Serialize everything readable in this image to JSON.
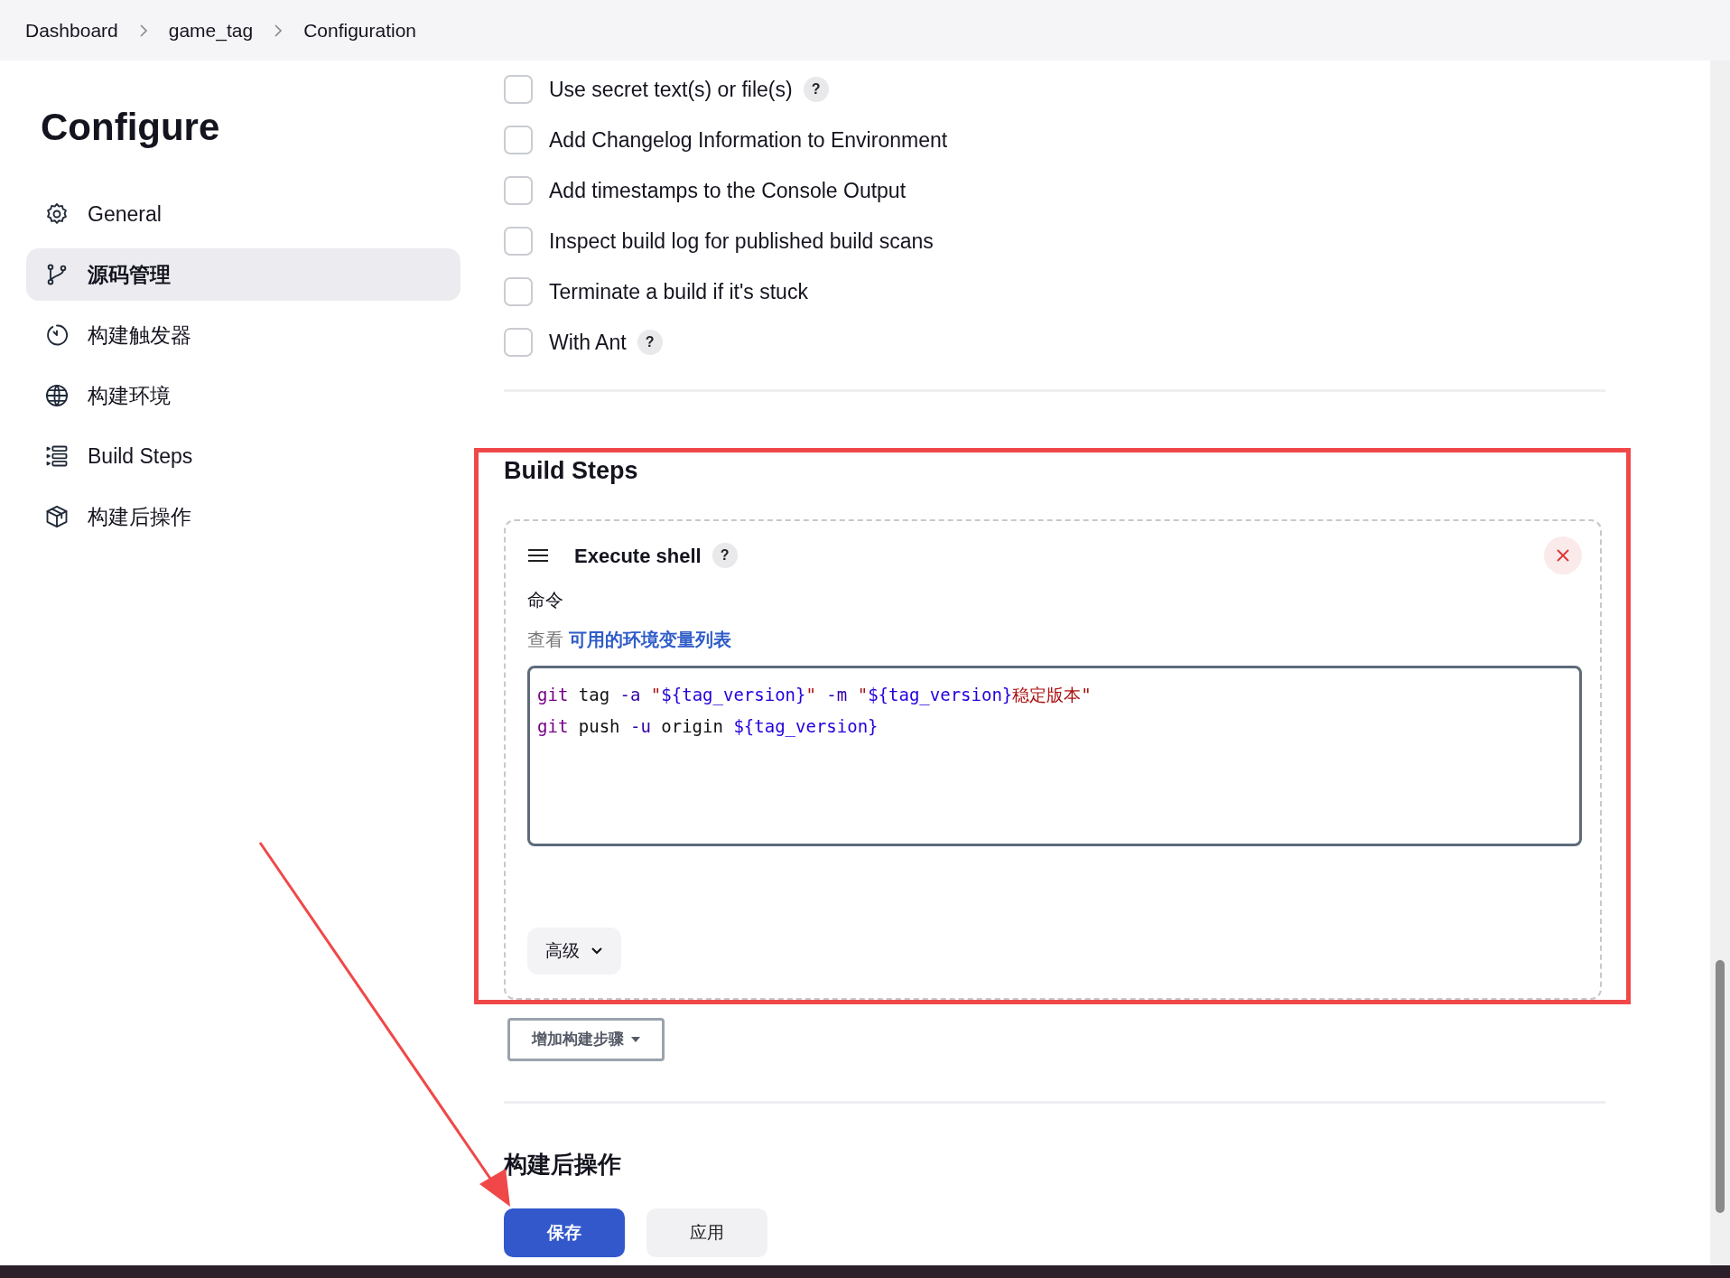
{
  "breadcrumbs": [
    "Dashboard",
    "game_tag",
    "Configuration"
  ],
  "sidebar": {
    "title": "Configure",
    "items": [
      {
        "label": "General",
        "selected": false
      },
      {
        "label": "源码管理",
        "selected": true
      },
      {
        "label": "构建触发器",
        "selected": false
      },
      {
        "label": "构建环境",
        "selected": false
      },
      {
        "label": "Build Steps",
        "selected": false
      },
      {
        "label": "构建后操作",
        "selected": false
      }
    ]
  },
  "options": [
    {
      "label": "Use secret text(s) or file(s)",
      "checked": false,
      "help": "?"
    },
    {
      "label": "Add Changelog Information to Environment",
      "checked": false
    },
    {
      "label": "Add timestamps to the Console Output",
      "checked": false
    },
    {
      "label": "Inspect build log for published build scans",
      "checked": false
    },
    {
      "label": "Terminate a build if it's stuck",
      "checked": false
    },
    {
      "label": "With Ant",
      "checked": false,
      "help": "?"
    }
  ],
  "build_steps": {
    "title": "Build Steps",
    "step": {
      "title": "Execute shell",
      "help": "?",
      "field_label": "命令",
      "hint_prefix": "查看",
      "hint_link": "可用的环境变量列表",
      "code": [
        [
          {
            "kind": "keyword",
            "text": "git"
          },
          {
            "kind": "plain",
            "text": " tag "
          },
          {
            "kind": "flag",
            "text": "-a "
          },
          {
            "kind": "string",
            "text": "\""
          },
          {
            "kind": "variable",
            "text": "${tag_version}"
          },
          {
            "kind": "string",
            "text": "\""
          },
          {
            "kind": "flag",
            "text": " -m "
          },
          {
            "kind": "string",
            "text": "\""
          },
          {
            "kind": "variable",
            "text": "${tag_version}"
          },
          {
            "kind": "string",
            "text": "稳定版本\""
          }
        ],
        [
          {
            "kind": "keyword",
            "text": "git"
          },
          {
            "kind": "plain",
            "text": " push "
          },
          {
            "kind": "flag",
            "text": "-u"
          },
          {
            "kind": "plain",
            "text": " origin "
          },
          {
            "kind": "variable",
            "text": "${tag_version}"
          }
        ]
      ],
      "advanced": "高级"
    },
    "add_button": "增加构建步骤"
  },
  "post_build": {
    "title": "构建后操作"
  },
  "buttons": [
    {
      "label": "保存",
      "kind": "primary"
    },
    {
      "label": "应用",
      "kind": "secondary"
    }
  ]
}
